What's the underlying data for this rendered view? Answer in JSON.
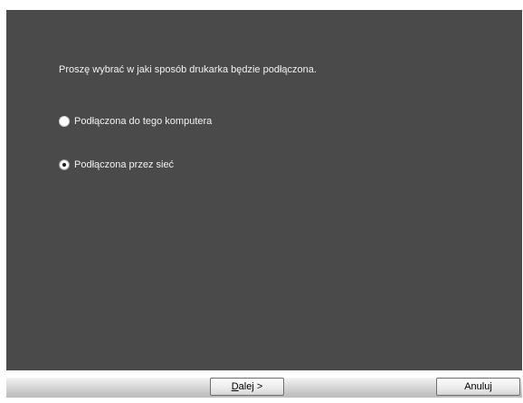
{
  "dialog": {
    "prompt": "Proszę wybrać w jaki sposób drukarka będzie podłączona.",
    "options": [
      {
        "label": "Podłączona do tego komputera",
        "selected": false
      },
      {
        "label": "Podłączona przez sieć",
        "selected": true
      }
    ]
  },
  "buttons": {
    "next_mnemonic": "D",
    "next_rest": "alej >",
    "cancel_label": "Anuluj"
  }
}
